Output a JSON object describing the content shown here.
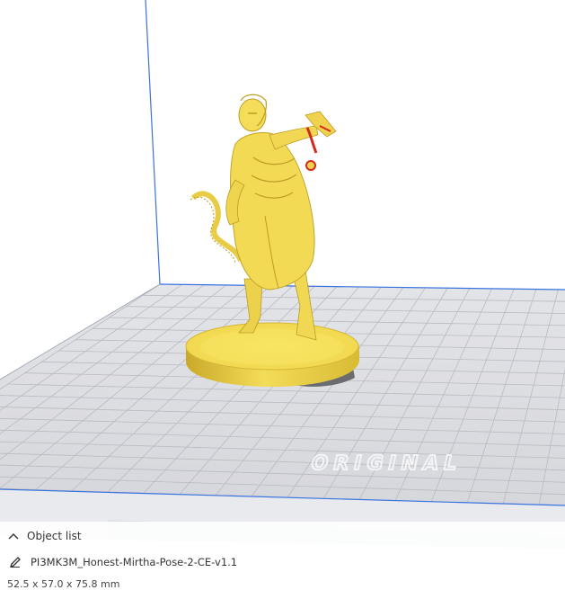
{
  "object_list": {
    "toggle_icon": "chevron-up-icon",
    "title": "Object list",
    "edit_icon": "pencil-icon",
    "object_name": "PI3MK3M_Honest-Mirtha-Pose-2-CE-v1.1",
    "dimensions": "52.5 x 57.0 x 75.8 mm"
  },
  "viewport": {
    "watermark": "ORIGINAL",
    "colors": {
      "model": "#f5e05c",
      "overhang": "#d42a1a",
      "plate": "#dcdde2",
      "grid": "#b9bbc2",
      "axis_blue": "#3a72e0"
    }
  }
}
